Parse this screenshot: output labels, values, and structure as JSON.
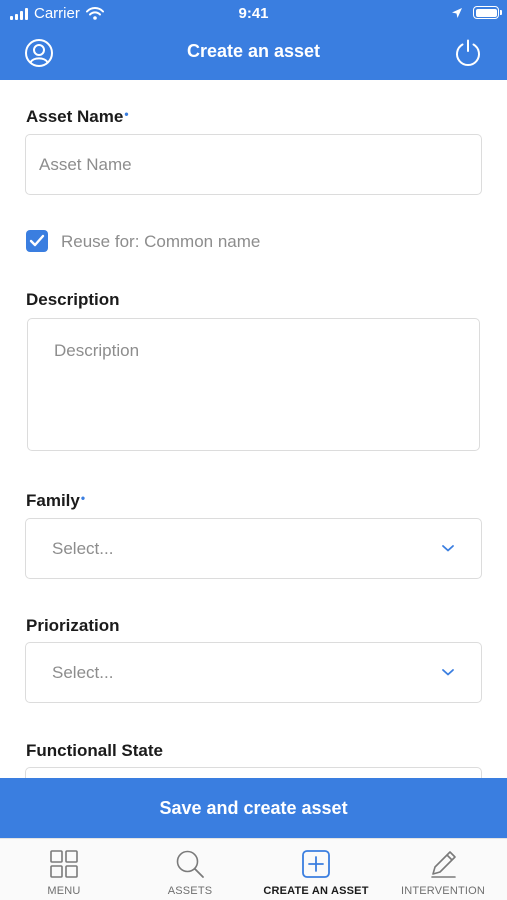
{
  "status_bar": {
    "carrier": "Carrier",
    "time": "9:41"
  },
  "header": {
    "title": "Create an asset"
  },
  "form": {
    "asset_name": {
      "label": "Asset Name",
      "required_mark": "•",
      "placeholder": "Asset Name"
    },
    "reuse": {
      "label": "Reuse for: Common name",
      "checked": true
    },
    "description": {
      "label": "Description",
      "placeholder": "Description"
    },
    "family": {
      "label": "Family",
      "required_mark": "•",
      "value": "Select..."
    },
    "priorization": {
      "label": "Priorization",
      "value": "Select..."
    },
    "functional_state": {
      "label": "Functionall State"
    }
  },
  "save_button": {
    "label": "Save and create asset"
  },
  "tabbar": {
    "tabs": [
      {
        "label": "MENU",
        "icon": "grid-icon",
        "active": false
      },
      {
        "label": "ASSETS",
        "icon": "search-icon",
        "active": false
      },
      {
        "label": "CREATE AN ASSET",
        "icon": "plus-square-icon",
        "active": true
      },
      {
        "label": "INTERVENTION",
        "icon": "pencil-icon",
        "active": false
      }
    ]
  },
  "colors": {
    "accent": "#3a7ee0",
    "border": "#dcdcdc",
    "placeholder": "#8d8d8d"
  }
}
